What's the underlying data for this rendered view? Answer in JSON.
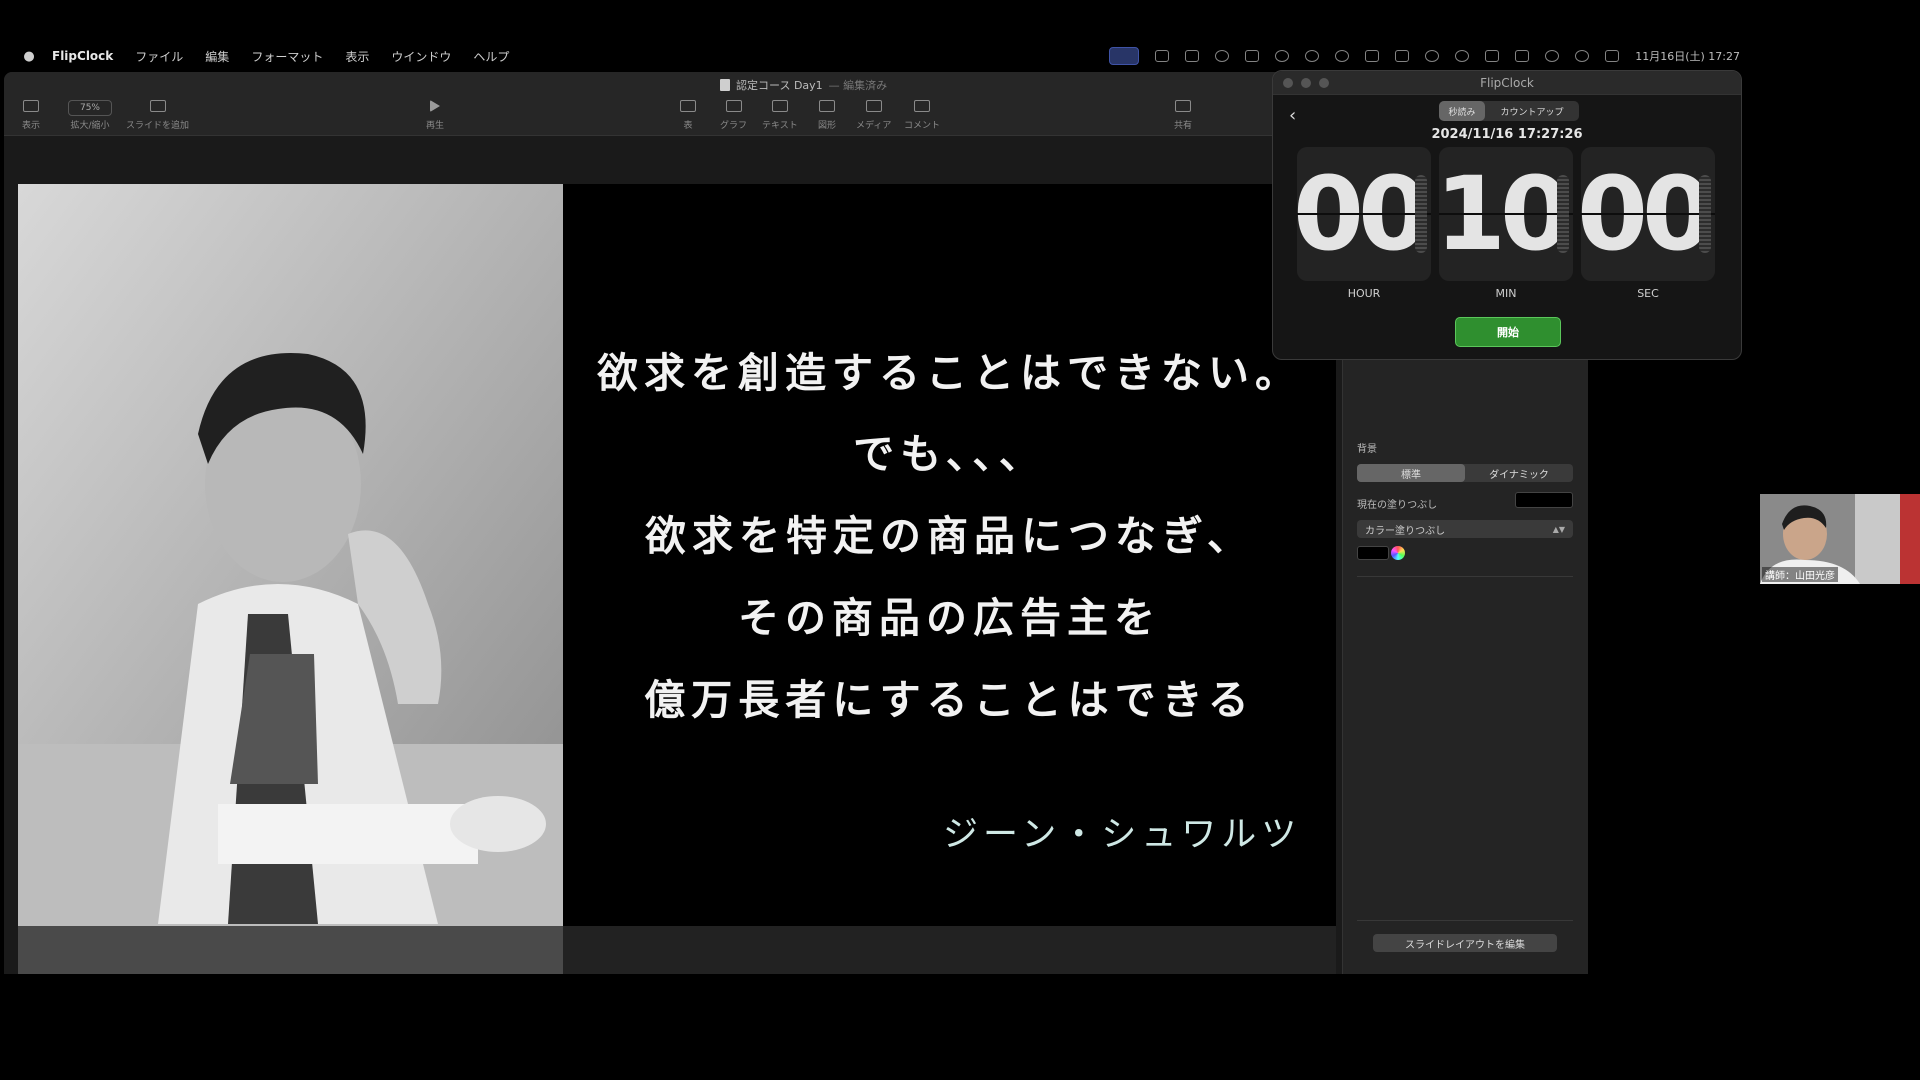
{
  "menubar": {
    "app_name": "FlipClock",
    "items": [
      "ファイル",
      "編集",
      "フォーマット",
      "表示",
      "ウインドウ",
      "ヘルプ"
    ],
    "clock": "11月16日(土) 17:27"
  },
  "keynote": {
    "doc_title": "認定コース Day1",
    "doc_status": "— 編集済み",
    "toolbar": {
      "view": "表示",
      "zoom_value": "75%",
      "zoom": "拡大/縮小",
      "add_slide": "スライドを追加",
      "play": "再生",
      "table": "表",
      "chart": "グラフ",
      "text": "テキスト",
      "shape": "図形",
      "media": "メディア",
      "comment": "コメント",
      "share": "共有"
    },
    "slide": {
      "lines": [
        "欲求を創造することはできない。",
        "でも、、、",
        "欲求を特定の商品につなぎ、",
        "その商品の広告主を",
        "億万長者にすることはできる"
      ],
      "author": "ジーン・シュワルツ"
    },
    "inspector": {
      "background_label": "背景",
      "seg_standard": "標準",
      "seg_dynamic": "ダイナミック",
      "current_fill": "現在の塗りつぶし",
      "fill_select": "カラー塗りつぶし",
      "edit_layout": "スライドレイアウトを編集"
    }
  },
  "flipclock": {
    "title": "FlipClock",
    "seg_countdown": "秒読み",
    "seg_countup": "カウントアップ",
    "datetime": "2024/11/16 17:27:26",
    "hour": "00",
    "min": "10",
    "sec": "00",
    "hour_label": "HOUR",
    "min_label": "MIN",
    "sec_label": "SEC",
    "start": "開始"
  },
  "webcam": {
    "name": "講師：山田光彦"
  }
}
